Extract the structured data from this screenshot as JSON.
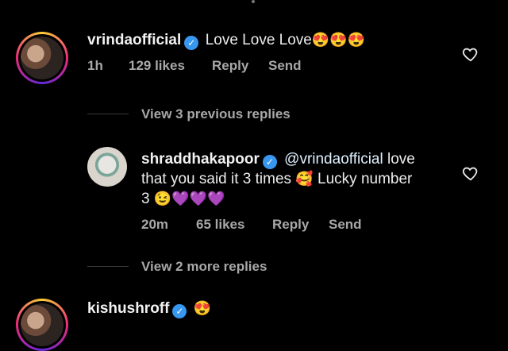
{
  "comment1": {
    "username": "vrindaofficial",
    "text": "Love Love Love",
    "emojis": "😍😍😍",
    "time": "1h",
    "likes": "129 likes",
    "reply": "Reply",
    "send": "Send"
  },
  "view_previous": "View 3 previous replies",
  "reply1": {
    "username": "shraddhakapoor",
    "mention": "@vrindaofficial",
    "text_line1": " love",
    "text_line2a": "that you said it 3 times ",
    "emoji_a": "🥰",
    "text_line2b": " Lucky number",
    "text_line3": "3 ",
    "emojis_b": "😉💜💜💜",
    "time": "20m",
    "likes": "65 likes",
    "reply": "Reply",
    "send": "Send"
  },
  "view_more": "View 2 more replies",
  "comment2": {
    "username": "kishushroff",
    "emojis": "😍"
  },
  "colors": {
    "background": "#000000",
    "verified": "#3897f0",
    "mention": "#e0f1ff",
    "meta": "#a8a8a8"
  }
}
